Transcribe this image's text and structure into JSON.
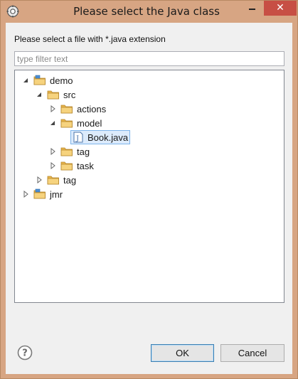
{
  "window": {
    "title": "Please select the Java class",
    "close_glyph": "✕"
  },
  "dialog": {
    "prompt": "Please select a file with *.java extension",
    "filter_placeholder": "type filter text"
  },
  "tree": {
    "nodes": [
      {
        "label": "demo",
        "icon": "project-folder-icon",
        "expanded": true,
        "depth": 0
      },
      {
        "label": "src",
        "icon": "source-folder-icon",
        "expanded": true,
        "depth": 1
      },
      {
        "label": "actions",
        "icon": "package-folder-icon",
        "expanded": false,
        "depth": 2
      },
      {
        "label": "model",
        "icon": "package-folder-icon",
        "expanded": true,
        "depth": 2
      },
      {
        "label": "Book.java",
        "icon": "java-file-icon",
        "selected": true,
        "depth": 3
      },
      {
        "label": "tag",
        "icon": "package-folder-icon",
        "expanded": false,
        "depth": 2
      },
      {
        "label": "task",
        "icon": "package-folder-icon",
        "expanded": false,
        "depth": 2
      },
      {
        "label": "tag",
        "icon": "folder-icon",
        "expanded": false,
        "depth": 1
      },
      {
        "label": "jmr",
        "icon": "project-folder-icon",
        "expanded": false,
        "depth": 0
      }
    ]
  },
  "buttons": {
    "ok": "OK",
    "cancel": "Cancel",
    "help": "?"
  },
  "colors": {
    "titlebar": "#d7a583",
    "close": "#c74f44",
    "selection_fill": "#dcebfc",
    "selection_border": "#7eb4ea",
    "folder": "#e8b54a"
  }
}
